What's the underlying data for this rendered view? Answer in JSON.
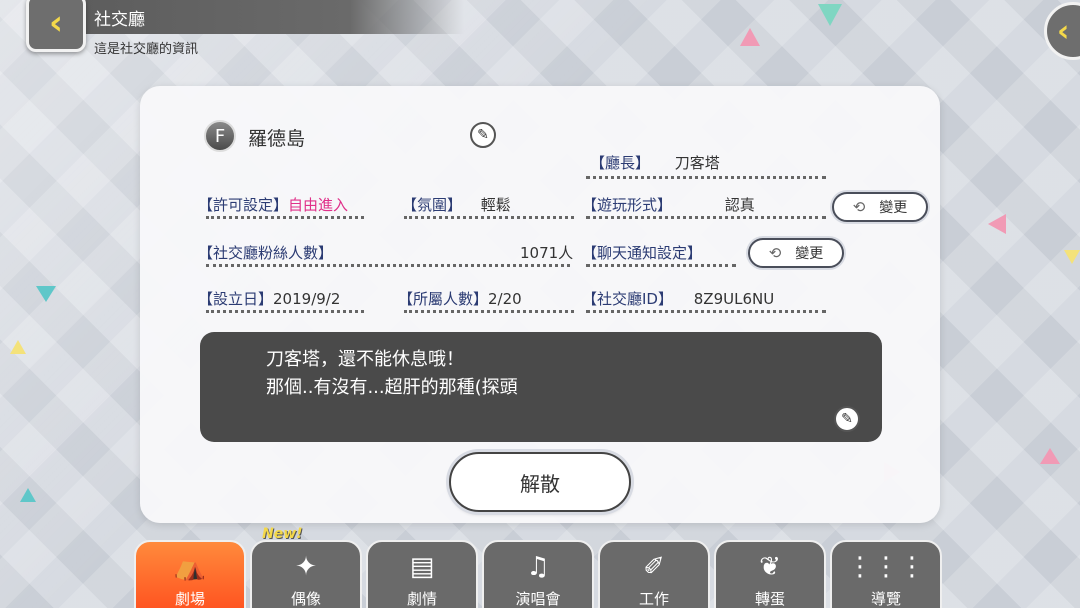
{
  "header": {
    "title": "社交廳",
    "subtitle": "這是社交廳的資訊",
    "back_icon": "chevron-left-icon"
  },
  "club": {
    "rank": "F",
    "name": "羅德島",
    "leader_label": "【廳長】",
    "leader_value": "刀客塔",
    "permission_label": "【許可設定】",
    "permission_value": "自由進入",
    "atmosphere_label": "【氛圍】",
    "atmosphere_value": "輕鬆",
    "playstyle_label": "【遊玩形式】",
    "playstyle_value": "認真",
    "fans_label": "【社交廳粉絲人數】",
    "fans_value": "1071人",
    "chat_label": "【聊天通知設定】",
    "founded_label": "【設立日】",
    "founded_value": "2019/9/2",
    "members_label": "【所屬人數】",
    "members_value": "2/20",
    "id_label": "【社交廳ID】",
    "id_value": "8Z9UL6NU",
    "change_label": "變更"
  },
  "message": {
    "line1": "刀客塔，還不能休息哦！",
    "line2": "那個..有沒有...超肝的那種(探頭"
  },
  "disband_label": "解散",
  "nav": {
    "new_badge": "New!",
    "items": [
      {
        "label": "劇場",
        "icon": "stage-icon",
        "active": true
      },
      {
        "label": "偶像",
        "icon": "idol-icon"
      },
      {
        "label": "劇情",
        "icon": "story-icon"
      },
      {
        "label": "演唱會",
        "icon": "music-note-icon"
      },
      {
        "label": "工作",
        "icon": "notebook-icon"
      },
      {
        "label": "轉蛋",
        "icon": "butterfly-icon"
      },
      {
        "label": "導覽",
        "icon": "grid-menu-icon"
      }
    ]
  },
  "colors": {
    "accent_pink": "#e0308a",
    "label_navy": "#2b3b73",
    "active_tab": "#ff5a22",
    "header_gray": "#5d5d5d"
  }
}
